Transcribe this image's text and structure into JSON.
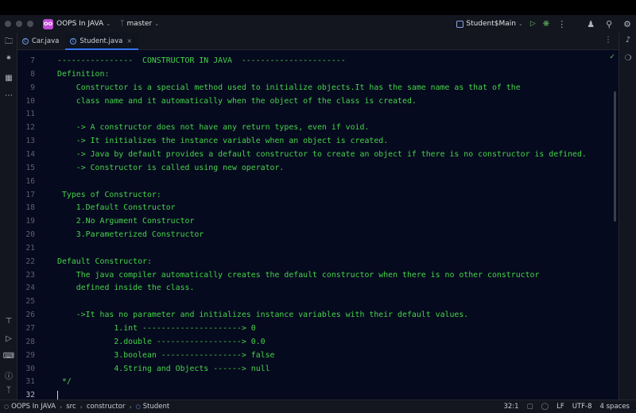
{
  "window": {
    "project_badge": "OO",
    "project_name": "OOPS In JAVA",
    "branch": "master",
    "run_config": "Student$Main"
  },
  "tabs": [
    {
      "label": "Car.java",
      "active": false
    },
    {
      "label": "Student.java",
      "active": true
    }
  ],
  "editor": {
    "lines": [
      {
        "n": "7",
        "text": "----------------  CONSTRUCTOR IN JAVA  ----------------------"
      },
      {
        "n": "8",
        "text": "Definition:"
      },
      {
        "n": "9",
        "text": "    Constructor is a special method used to initialize objects.It has the same name as that of the"
      },
      {
        "n": "10",
        "text": "    class name and it automatically when the object of the class is created."
      },
      {
        "n": "11",
        "text": ""
      },
      {
        "n": "12",
        "text": "    -> A constructor does not have any return types, even if void."
      },
      {
        "n": "13",
        "text": "    -> It initializes the instance variable when an object is created."
      },
      {
        "n": "14",
        "text": "    -> Java by default provides a default constructor to create an object if there is no constructor is defined."
      },
      {
        "n": "15",
        "text": "    -> Constructor is called using new operator."
      },
      {
        "n": "16",
        "text": ""
      },
      {
        "n": "17",
        "text": " Types of Constructor:"
      },
      {
        "n": "18",
        "text": "    1.Default Constructor"
      },
      {
        "n": "19",
        "text": "    2.No Argument Constructor"
      },
      {
        "n": "20",
        "text": "    3.Parameterized Constructor"
      },
      {
        "n": "21",
        "text": ""
      },
      {
        "n": "22",
        "text": "Default Constructor:"
      },
      {
        "n": "23",
        "text": "    The java compiler automatically creates the default constructor when there is no other constructor"
      },
      {
        "n": "24",
        "text": "    defined inside the class."
      },
      {
        "n": "25",
        "text": ""
      },
      {
        "n": "26",
        "text": "    ->It has no parameter and initializes instance variables with their default values."
      },
      {
        "n": "27",
        "text": "            1.int ---------------------> 0"
      },
      {
        "n": "28",
        "text": "            2.double ------------------> 0.0"
      },
      {
        "n": "29",
        "text": "            3.boolean -----------------> false"
      },
      {
        "n": "30",
        "text": "            4.String and Objects ------> null"
      },
      {
        "n": "31",
        "text": " */"
      },
      {
        "n": "32",
        "text": ""
      }
    ]
  },
  "statusbar": {
    "project": "OOPS In JAVA",
    "src": "src",
    "package": "constructor",
    "class": "Student",
    "position": "32:1",
    "line_ending": "LF",
    "encoding": "UTF-8",
    "indent": "4 spaces"
  }
}
